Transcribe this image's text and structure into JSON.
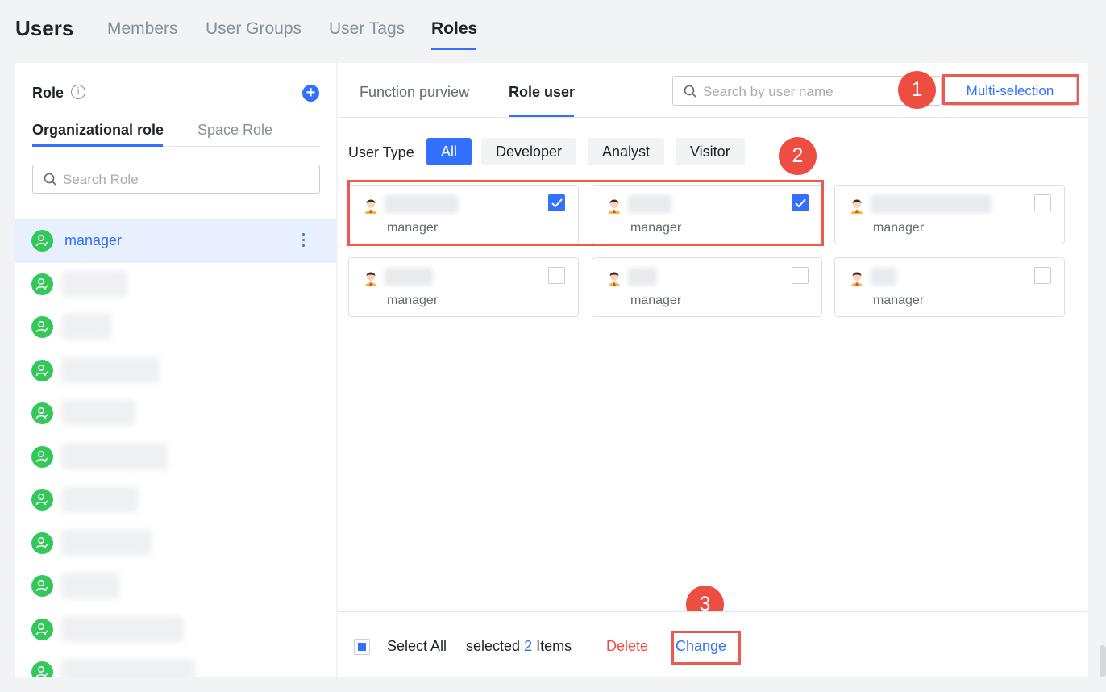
{
  "app": {
    "title": "Users"
  },
  "top_tabs": [
    {
      "label": "Members",
      "active": false
    },
    {
      "label": "User Groups",
      "active": false
    },
    {
      "label": "User Tags",
      "active": false
    },
    {
      "label": "Roles",
      "active": true
    }
  ],
  "left_panel": {
    "heading": "Role",
    "info_icon": "info-icon",
    "add_icon": "plus-circle-icon",
    "tabs": [
      {
        "label": "Organizational role",
        "active": true
      },
      {
        "label": "Space Role",
        "active": false
      }
    ],
    "search_placeholder": "Search Role",
    "roles": [
      {
        "label": "manager",
        "active": true
      }
    ]
  },
  "right_panel": {
    "tabs": [
      {
        "label": "Function purview",
        "active": false
      },
      {
        "label": "Role user",
        "active": true
      }
    ],
    "search_placeholder": "Search by user name",
    "multi_selection_label": "Multi-selection",
    "user_type_label": "User Type",
    "filters": [
      {
        "label": "All",
        "active": true
      },
      {
        "label": "Developer",
        "active": false
      },
      {
        "label": "Analyst",
        "active": false
      },
      {
        "label": "Visitor",
        "active": false
      }
    ],
    "users": [
      {
        "role": "manager",
        "checked": true
      },
      {
        "role": "manager",
        "checked": true
      },
      {
        "role": "manager",
        "checked": false
      },
      {
        "role": "manager",
        "checked": false
      },
      {
        "role": "manager",
        "checked": false
      },
      {
        "role": "manager",
        "checked": false
      }
    ]
  },
  "footer": {
    "select_all_label": "Select All",
    "selected_prefix": "selected",
    "selected_count": "2",
    "selected_suffix": "Items",
    "delete_label": "Delete",
    "change_label": "Change"
  },
  "annotations": {
    "badge_1": "1",
    "badge_2": "2",
    "badge_3": "3"
  },
  "colors": {
    "accent": "#3370ff",
    "danger": "#f54a45",
    "annotation_red": "#ee4e42",
    "role_avatar": "#34c759"
  }
}
